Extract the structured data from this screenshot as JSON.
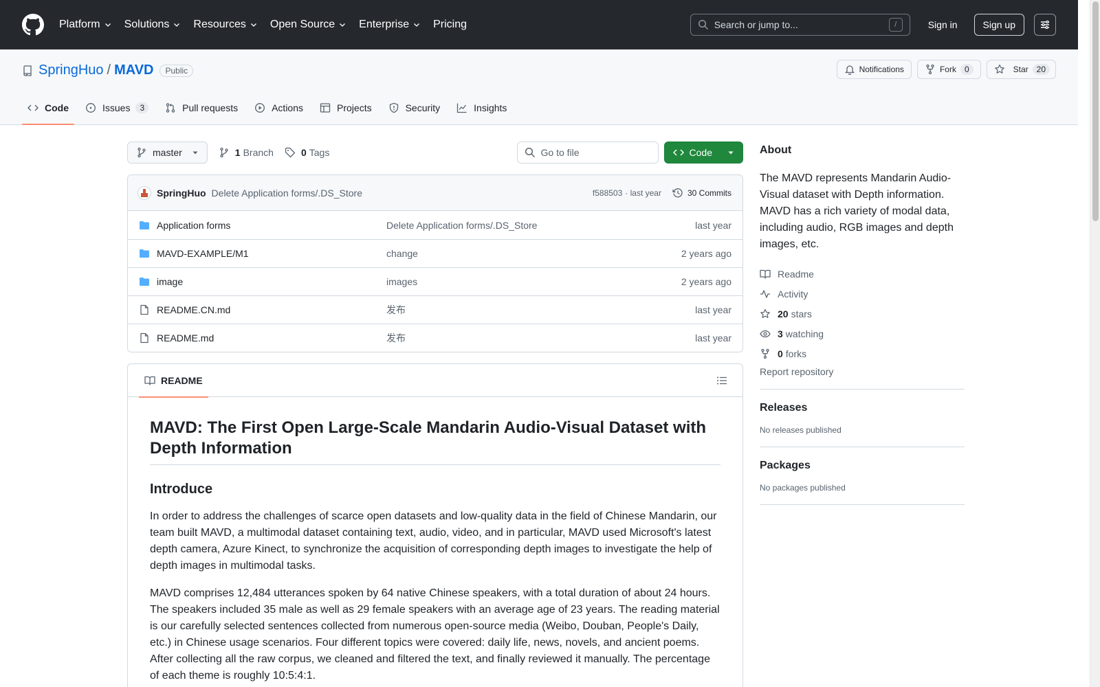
{
  "header": {
    "nav": [
      "Platform",
      "Solutions",
      "Resources",
      "Open Source",
      "Enterprise",
      "Pricing"
    ],
    "search_placeholder": "Search or jump to...",
    "search_shortcut": "/",
    "sign_in": "Sign in",
    "sign_up": "Sign up"
  },
  "repo": {
    "owner": "SpringHuo",
    "separator": "/",
    "name": "MAVD",
    "visibility": "Public",
    "notifications_label": "Notifications",
    "fork_label": "Fork",
    "fork_count": "0",
    "star_label": "Star",
    "star_count": "20"
  },
  "tabs": [
    {
      "label": "Code",
      "active": true
    },
    {
      "label": "Issues",
      "count": "3"
    },
    {
      "label": "Pull requests"
    },
    {
      "label": "Actions"
    },
    {
      "label": "Projects"
    },
    {
      "label": "Security"
    },
    {
      "label": "Insights"
    }
  ],
  "filenav": {
    "branch": "master",
    "branch_count": "1",
    "branch_label": "Branch",
    "tag_count": "0",
    "tag_label": "Tags",
    "goto_placeholder": "Go to file",
    "code_button": "Code"
  },
  "commit": {
    "author": "SpringHuo",
    "message": "Delete Application forms/.DS_Store",
    "hash": "f588503",
    "time": "· last year",
    "commits": "30 Commits"
  },
  "files": [
    {
      "type": "folder",
      "name": "Application forms",
      "message": "Delete Application forms/.DS_Store",
      "date": "last year"
    },
    {
      "type": "folder",
      "name": "MAVD-EXAMPLE/M1",
      "message": "change",
      "date": "2 years ago"
    },
    {
      "type": "folder",
      "name": "image",
      "message": "images",
      "date": "2 years ago"
    },
    {
      "type": "file",
      "name": "README.CN.md",
      "message": "发布",
      "date": "last year"
    },
    {
      "type": "file",
      "name": "README.md",
      "message": "发布",
      "date": "last year"
    }
  ],
  "readme": {
    "tab": "README",
    "title": "MAVD: The First Open Large-Scale Mandarin Audio-Visual Dataset with Depth Information",
    "subtitle": "Introduce",
    "para1": "In order to address the challenges of scarce open datasets and low-quality data in the field of Chinese Mandarin, our team built MAVD, a multimodal dataset containing text, audio, video, and in particular, MAVD used Microsoft's latest depth camera, Azure Kinect, to synchronize the acquisition of corresponding depth images to investigate the help of depth images in multimodal tasks.",
    "para2": "MAVD comprises 12,484 utterances spoken by 64 native Chinese speakers, with a total duration of about 24 hours. The speakers included 35 male as well as 29 female speakers with an average age of 23 years. The reading material is our carefully selected sentences collected from numerous open-source media (Weibo, Douban, People's Daily, etc.) in Chinese usage scenarios. Four different topics were covered: daily life, news, novels, and ancient poems. After collecting all the raw corpus, we cleaned and filtered the text, and finally reviewed it manually. The percentage of each theme is roughly 10:5:4:1."
  },
  "about": {
    "title": "About",
    "description": "The MAVD represents Mandarin Audio-Visual dataset with Depth information. MAVD has a rich variety of modal data, including audio, RGB images and depth images, etc.",
    "readme": "Readme",
    "activity": "Activity",
    "stars_count": "20",
    "stars_label": "stars",
    "watching_count": "3",
    "watching_label": "watching",
    "forks_count": "0",
    "forks_label": "forks",
    "report": "Report repository"
  },
  "releases": {
    "title": "Releases",
    "text": "No releases published"
  },
  "packages": {
    "title": "Packages",
    "text": "No packages published"
  },
  "colors": {
    "header_bg": "#25292e",
    "link": "#0969da",
    "code_button": "#1f883d",
    "active_tab_underline": "#fd8c73",
    "folder_icon": "#54aeff"
  }
}
